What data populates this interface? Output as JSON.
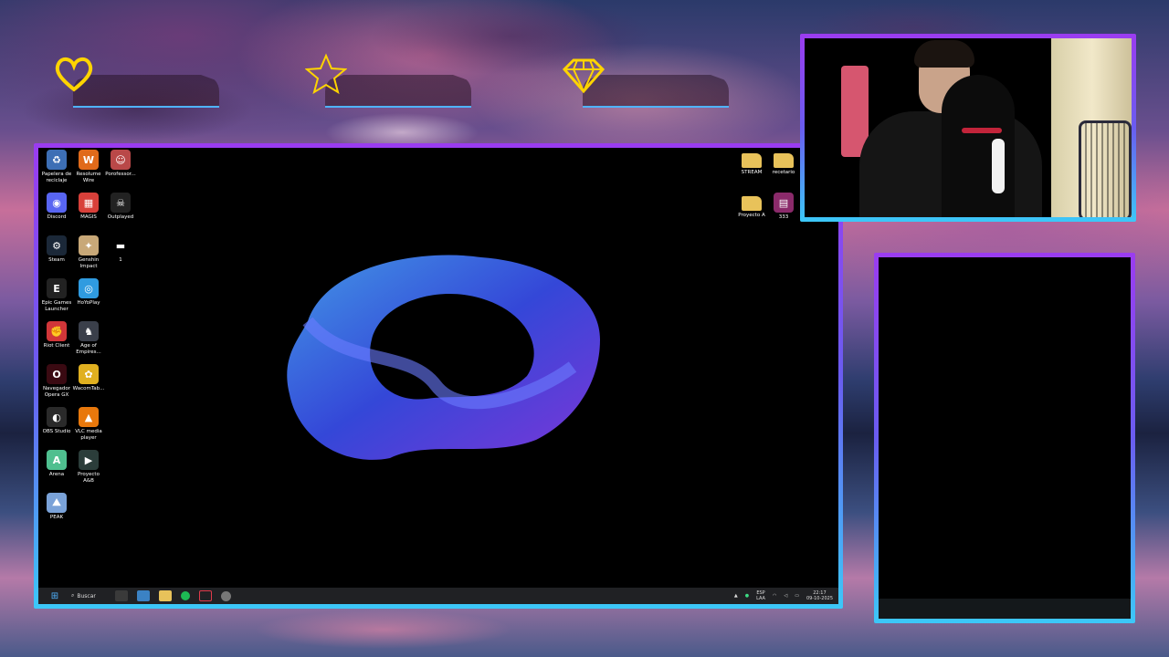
{
  "overlay": {
    "stats": [
      {
        "icon": "heart-icon",
        "label": "",
        "color": "#ffd400"
      },
      {
        "icon": "star-icon",
        "label": "",
        "color": "#ffd400"
      },
      {
        "icon": "diamond-icon",
        "label": "",
        "color": "#ffd400"
      }
    ],
    "accent_top": "#9b3cf0",
    "accent_bottom": "#3cc8f8"
  },
  "desktop": {
    "left_icons": [
      {
        "label": "Papelera de reciclaje",
        "icon": "recycle-bin-icon",
        "color": "#3d6fb5",
        "glyph": "♻"
      },
      {
        "label": "Resolume Wire",
        "icon": "resolume-wire-icon",
        "color": "#e06a1a",
        "glyph": "W"
      },
      {
        "label": "Porofessor...",
        "icon": "porofessor-icon",
        "color": "#b94848",
        "glyph": "☺"
      },
      {
        "label": "Discord",
        "icon": "discord-icon",
        "color": "#5865f2",
        "glyph": "◉"
      },
      {
        "label": "MAGIS",
        "icon": "magis-icon",
        "color": "#d8403a",
        "glyph": "▦"
      },
      {
        "label": "Outplayed",
        "icon": "outplayed-icon",
        "color": "#222",
        "glyph": "☠"
      },
      {
        "label": "Steam",
        "icon": "steam-icon",
        "color": "#1b2838",
        "glyph": "⚙"
      },
      {
        "label": "Genshin Impact",
        "icon": "genshin-icon",
        "color": "#c8a878",
        "glyph": "✦"
      },
      {
        "label": "1",
        "icon": "file-icon",
        "color": "#000",
        "glyph": "▬"
      },
      {
        "label": "Epic Games Launcher",
        "icon": "epic-games-icon",
        "color": "#222",
        "glyph": "E"
      },
      {
        "label": "HoYoPlay",
        "icon": "hoyoplay-icon",
        "color": "#2f9be0",
        "glyph": "◎"
      },
      {
        "label": "Riot Client",
        "icon": "riot-client-icon",
        "color": "#d13639",
        "glyph": "✊"
      },
      {
        "label": "Age of Empires...",
        "icon": "age-of-empires-icon",
        "color": "#3a3f4a",
        "glyph": "♞"
      },
      {
        "label": "Navegador Opera GX",
        "icon": "opera-gx-icon",
        "color": "#3a0a12",
        "glyph": "O"
      },
      {
        "label": "WacomTab...",
        "icon": "wacom-icon",
        "color": "#e0b020",
        "glyph": "✿"
      },
      {
        "label": "OBS Studio",
        "icon": "obs-icon",
        "color": "#2a2a2a",
        "glyph": "◐"
      },
      {
        "label": "VLC media player",
        "icon": "vlc-icon",
        "color": "#e8780c",
        "glyph": "▲"
      },
      {
        "label": "Arena",
        "icon": "arena-icon",
        "color": "#4fbf8f",
        "glyph": "A"
      },
      {
        "label": "Proyecto A&B",
        "icon": "file-icon",
        "color": "#2b3d3a",
        "glyph": "▶"
      },
      {
        "label": "PEAK",
        "icon": "peak-icon",
        "color": "#7aa2d8",
        "glyph": "⛰"
      }
    ],
    "right_icons": [
      {
        "label": "STREAM",
        "icon": "folder-icon",
        "color": "#e8c25a",
        "glyph": ""
      },
      {
        "label": "recetario",
        "icon": "folder-icon",
        "color": "#e8c25a",
        "glyph": ""
      },
      {
        "label": "Proyecto A",
        "icon": "folder-icon",
        "color": "#e8c25a",
        "glyph": ""
      },
      {
        "label": "333",
        "icon": "winrar-icon",
        "color": "#8a2a6a",
        "glyph": "▤"
      }
    ],
    "taskbar": {
      "search_label": "Buscar",
      "lang_top": "ESP",
      "lang_bottom": "LAA",
      "time": "22:17",
      "date": "09-10-2025"
    }
  }
}
